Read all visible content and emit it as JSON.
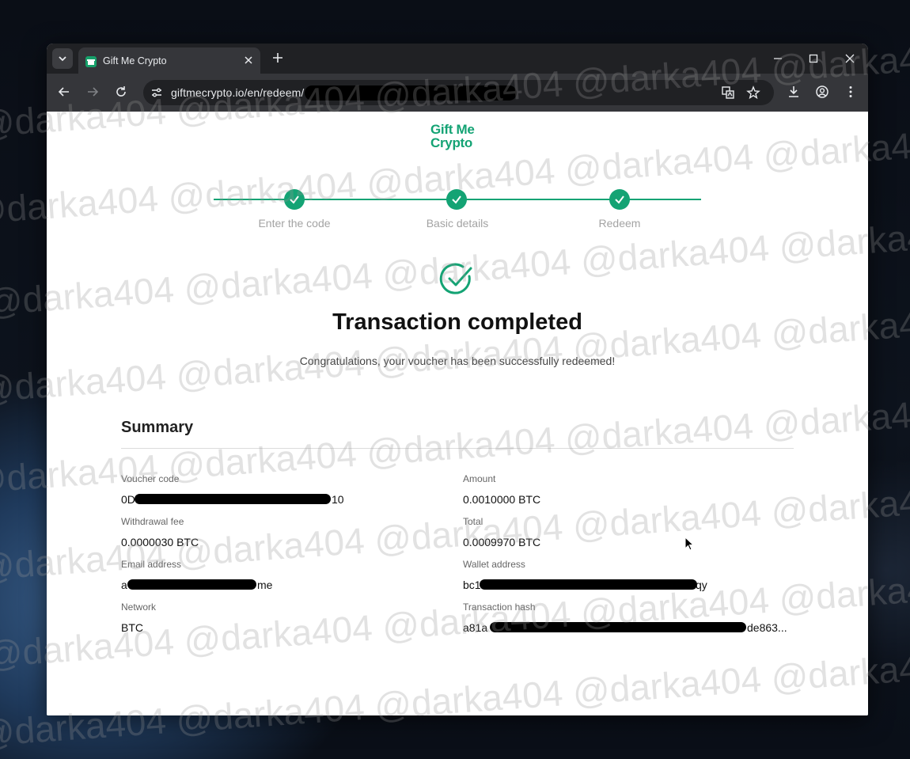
{
  "browser": {
    "tab_title": "Gift Me Crypto",
    "url": "giftmecrypto.io/en/redeem/"
  },
  "page": {
    "logo_line1": "Gift Me",
    "logo_line2": "Crypto",
    "steps": [
      {
        "label": "Enter the code",
        "completed": true
      },
      {
        "label": "Basic details",
        "completed": true
      },
      {
        "label": "Redeem",
        "completed": true
      }
    ],
    "title": "Transaction completed",
    "subtitle": "Congratulations, your voucher has been successfully redeemed!",
    "summary": {
      "heading": "Summary",
      "voucher_code": {
        "label": "Voucher code",
        "prefix": "0D",
        "suffix": "10"
      },
      "amount": {
        "label": "Amount",
        "value": "0.0010000 BTC"
      },
      "withdrawal_fee": {
        "label": "Withdrawal fee",
        "value": "0.0000030 BTC"
      },
      "total": {
        "label": "Total",
        "value": "0.0009970 BTC"
      },
      "email": {
        "label": "Email address",
        "prefix": "a",
        "suffix": "me"
      },
      "wallet": {
        "label": "Wallet address",
        "prefix": "bc1",
        "suffix": "qy"
      },
      "network": {
        "label": "Network",
        "value": "BTC"
      },
      "tx_hash": {
        "label": "Transaction hash",
        "prefix": "a81a",
        "suffix": "de863..."
      }
    }
  },
  "watermark_text": "@darka404 @darka404 @darka404 @darka404 @darka404",
  "colors": {
    "accent": "#14a374",
    "chrome_dark": "#202124",
    "chrome_toolbar": "#35363a"
  }
}
